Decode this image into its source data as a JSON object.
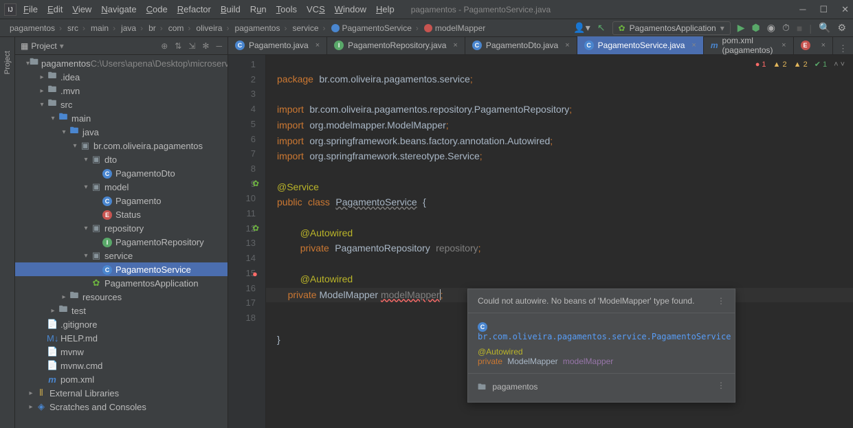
{
  "window": {
    "title": "pagamentos - PagamentoService.java",
    "menu": [
      "File",
      "Edit",
      "View",
      "Navigate",
      "Code",
      "Refactor",
      "Build",
      "Run",
      "Tools",
      "VCS",
      "Window",
      "Help"
    ]
  },
  "breadcrumb": [
    "pagamentos",
    "src",
    "main",
    "java",
    "br",
    "com",
    "oliveira",
    "pagamentos",
    "service",
    "PagamentoService",
    "modelMapper"
  ],
  "runConfig": "PagamentosApplication",
  "project": {
    "header": "Project",
    "root": "pagamentos",
    "rootPath": "C:\\Users\\apena\\Desktop\\microservice",
    "nodes": [
      {
        "d": 1,
        "arr": "▾",
        "icon": "folder",
        "label": "pagamentos",
        "suffix": " C:\\Users\\apena\\Desktop\\microservice"
      },
      {
        "d": 2,
        "arr": "▸",
        "icon": "folder",
        "label": ".idea"
      },
      {
        "d": 2,
        "arr": "▸",
        "icon": "folder",
        "label": ".mvn"
      },
      {
        "d": 2,
        "arr": "▾",
        "icon": "folder",
        "label": "src"
      },
      {
        "d": 3,
        "arr": "▾",
        "icon": "folder-blue",
        "label": "main"
      },
      {
        "d": 4,
        "arr": "▾",
        "icon": "folder-blue",
        "label": "java"
      },
      {
        "d": 5,
        "arr": "▾",
        "icon": "pkg",
        "label": "br.com.oliveira.pagamentos"
      },
      {
        "d": 6,
        "arr": "▾",
        "icon": "pkg",
        "label": "dto"
      },
      {
        "d": 7,
        "arr": "",
        "icon": "class",
        "label": "PagamentoDto"
      },
      {
        "d": 6,
        "arr": "▾",
        "icon": "pkg",
        "label": "model"
      },
      {
        "d": 7,
        "arr": "",
        "icon": "class",
        "label": "Pagamento"
      },
      {
        "d": 7,
        "arr": "",
        "icon": "enum",
        "label": "Status"
      },
      {
        "d": 6,
        "arr": "▾",
        "icon": "pkg",
        "label": "repository"
      },
      {
        "d": 7,
        "arr": "",
        "icon": "iface",
        "label": "PagamentoRepository"
      },
      {
        "d": 6,
        "arr": "▾",
        "icon": "pkg",
        "label": "service"
      },
      {
        "d": 7,
        "arr": "",
        "icon": "class",
        "label": "PagamentoService",
        "selected": true
      },
      {
        "d": 6,
        "arr": "",
        "icon": "spring",
        "label": "PagamentosApplication"
      },
      {
        "d": 4,
        "arr": "▸",
        "icon": "folder",
        "label": "resources"
      },
      {
        "d": 3,
        "arr": "▸",
        "icon": "folder",
        "label": "test"
      },
      {
        "d": 2,
        "arr": "",
        "icon": "file",
        "label": ".gitignore"
      },
      {
        "d": 2,
        "arr": "",
        "icon": "md",
        "label": "HELP.md"
      },
      {
        "d": 2,
        "arr": "",
        "icon": "file",
        "label": "mvnw"
      },
      {
        "d": 2,
        "arr": "",
        "icon": "file",
        "label": "mvnw.cmd"
      },
      {
        "d": 2,
        "arr": "",
        "icon": "maven",
        "label": "pom.xml"
      },
      {
        "d": 1,
        "arr": "▸",
        "icon": "lib",
        "label": "External Libraries"
      },
      {
        "d": 1,
        "arr": "▸",
        "icon": "scratch",
        "label": "Scratches and Consoles"
      }
    ]
  },
  "tabs": [
    {
      "icon": "class",
      "label": "Pagamento.java"
    },
    {
      "icon": "iface",
      "label": "PagamentoRepository.java"
    },
    {
      "icon": "class",
      "label": "PagamentoDto.java"
    },
    {
      "icon": "class",
      "label": "PagamentoService.java",
      "active": true
    },
    {
      "icon": "maven",
      "label": "pom.xml (pagamentos)"
    },
    {
      "icon": "enum",
      "label": ""
    }
  ],
  "inspections": {
    "errors": "1",
    "warn1": "2",
    "warn2": "2",
    "ok": "1"
  },
  "code": {
    "lines": [
      "1",
      "2",
      "3",
      "4",
      "5",
      "6",
      "7",
      "8",
      "9",
      "10",
      "11",
      "12",
      "13",
      "14",
      "15",
      "16",
      "17",
      "18"
    ],
    "l1_pkg": "package",
    "l1_path": "br.com.oliveira.pagamentos.service",
    "l3_imp": "import",
    "l3_path": "br.com.oliveira.pagamentos.repository.PagamentoRepository",
    "l4_path": "org.modelmapper.ModelMapper",
    "l5_path": "org.springframework.beans.factory.annotation.",
    "l5_cls": "Autowired",
    "l6_path": "org.springframework.stereotype.",
    "l6_cls": "Service",
    "l8": "@Service",
    "l9_a": "public",
    "l9_b": "class",
    "l9_c": "PagamentoService",
    "l9_d": "{",
    "l11": "@Autowired",
    "l12_a": "private",
    "l12_b": "PagamentoRepository",
    "l12_c": "repository",
    "l14": "@Autowired",
    "l15_a": "private",
    "l15_b": "ModelMapper",
    "l15_c": "modelMapper",
    "l17": "}"
  },
  "tooltip": {
    "msg": "Could not autowire. No beans of 'ModelMapper' type found.",
    "classLink": "br.com.oliveira.pagamentos.service.PagamentoService",
    "ann": "@Autowired",
    "priv": "private",
    "type": "ModelMapper",
    "field": "modelMapper",
    "module": "pagamentos"
  }
}
